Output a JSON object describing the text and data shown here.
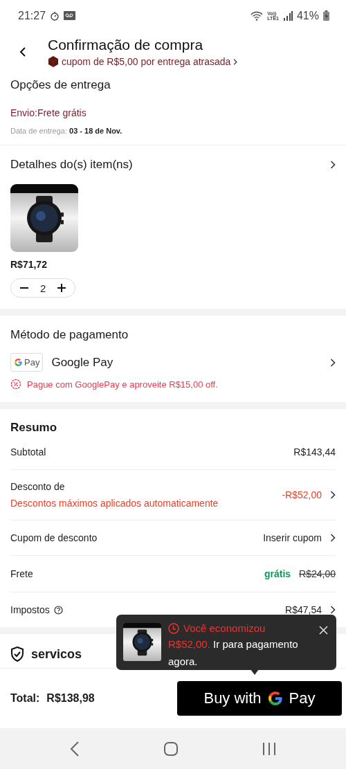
{
  "status_bar": {
    "time": "21:27",
    "volte": "Vo))",
    "network": "LTE1",
    "battery": "41%"
  },
  "header": {
    "title": "Confirmação de compra",
    "coupon": "cupom de R$5,00 por entrega atrasada"
  },
  "delivery": {
    "title": "Opções de entrega",
    "shipping": "Envio:Frete grátis",
    "date": "Data de entrega: **03 - 18 de Nov.**"
  },
  "items": {
    "title": "Detalhes do(s) item(ns)",
    "products": [
      {
        "kind": "picture",
        "price": "R$71,72",
        "quantity": "2"
      }
    ]
  },
  "payment": {
    "title": "Método de pagamento",
    "logo_text": "Pay",
    "method": "Google Pay",
    "promo": "Pague com GooglePay e aproveite R$15,00 off."
  },
  "summary": {
    "title": "Resumo",
    "rows": [
      {
        "kind": "plain",
        "label": "Subtotal",
        "value": "R$143,44",
        "chevron": false
      },
      {
        "kind": "discount",
        "label": "Desconto de",
        "note": "Descontos máximos aplicados automaticamente",
        "value": "-R$52,00",
        "chevron": true
      },
      {
        "kind": "plain",
        "label": "Cupom de desconto",
        "value": "Inserir cupom",
        "chevron": true
      },
      {
        "kind": "shipping",
        "label": "Frete",
        "value": "grátis",
        "old_value": "R$24,00",
        "chevron": false
      },
      {
        "kind": "tax",
        "label": "Impostos",
        "value": "R$47,54",
        "chevron": true
      }
    ]
  },
  "services": {
    "title": "servicos"
  },
  "footer": {
    "total_label": "Total:",
    "total": "R$138,98",
    "button_text": "Buy with",
    "button_brand": "Pay"
  },
  "toast": {
    "title": "Você economizou",
    "amount": "R$52,00.",
    "message": "Ir para pagamento agora."
  }
}
